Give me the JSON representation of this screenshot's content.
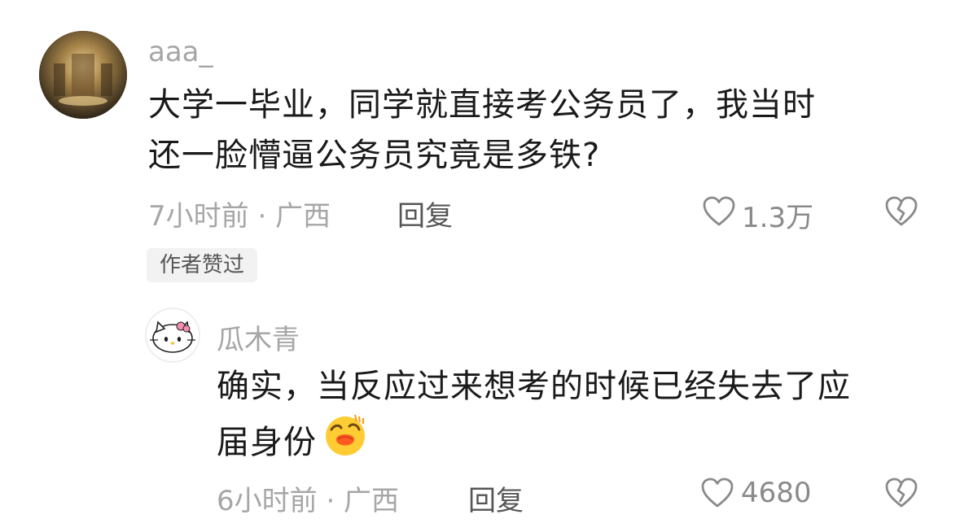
{
  "comment": {
    "username": "aaa_",
    "lines": [
      "大学一毕业，同学就直接考公务员了，我当时",
      "还一脸懵逼公务员究竟是多铁?"
    ],
    "meta": "7小时前 · 广西",
    "reply_label": "回复",
    "like_count": "1.3万",
    "badge": "作者赞过",
    "icons": [
      "heart-icon",
      "broken-heart-icon"
    ]
  },
  "reply": {
    "username": "瓜木青",
    "lines": [
      "确实，当反应过来想考的时候已经失去了应",
      "届身份"
    ],
    "emoji": "face-emoji",
    "meta": "6小时前 · 广西",
    "reply_label": "回复",
    "like_count": "4680",
    "icons": [
      "heart-icon",
      "broken-heart-icon"
    ]
  }
}
